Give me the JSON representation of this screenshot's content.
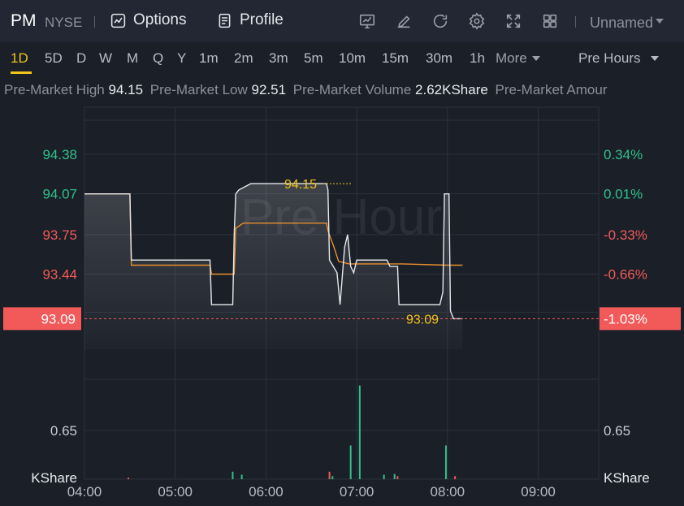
{
  "header": {
    "symbol": "PM",
    "exchange": "NYSE",
    "options_label": "Options",
    "profile_label": "Profile",
    "tools": [
      "chart-icon",
      "pencil-icon",
      "refresh-icon",
      "gear-icon",
      "fullscreen-icon",
      "grid-icon"
    ],
    "layout_name": "Unnamed"
  },
  "periods": {
    "items": [
      "1D",
      "5D",
      "D",
      "W",
      "M",
      "Q",
      "Y",
      "1m",
      "2m",
      "3m",
      "5m",
      "10m",
      "15m",
      "30m",
      "1h"
    ],
    "active": "1D",
    "more_label": "More",
    "session_label": "Pre Hours"
  },
  "stats": {
    "high_label": "Pre-Market High",
    "high_value": "94.15",
    "low_label": "Pre-Market Low",
    "low_value": "92.51",
    "volume_label": "Pre-Market Volume",
    "volume_value": "2.62KShare",
    "amount_label": "Pre-Market Amour"
  },
  "chart_data": {
    "type": "line",
    "watermark": "Pre Hour",
    "x_ticks": [
      "04:00",
      "05:00",
      "06:00",
      "07:00",
      "08:00",
      "09:00"
    ],
    "price_ticks": [
      94.38,
      94.07,
      93.75,
      93.44
    ],
    "price_tick_labels": [
      "94.38",
      "94.07",
      "93.75",
      "93.44"
    ],
    "pct_tick_labels": [
      "0.34%",
      "0.01%",
      "-0.33%",
      "-0.66%"
    ],
    "current_price": "93.09",
    "current_pct": "-1.03%",
    "high_marker": "94.15",
    "volume_tick": "0.65",
    "volume_unit": "KShare",
    "colors": {
      "up": "#2fc18a",
      "down": "#f25a5a",
      "price_line": "#e6e8ec",
      "avg_line": "#e8912c",
      "accent": "#f0c419",
      "current_badge": "#f25a5a"
    },
    "y_range": [
      92.85,
      94.75
    ],
    "price_series": [
      [
        "04:00",
        94.07
      ],
      [
        "04:30",
        94.07
      ],
      [
        "04:31",
        93.55
      ],
      [
        "05:00",
        93.55
      ],
      [
        "05:23",
        93.55
      ],
      [
        "05:24",
        93.2
      ],
      [
        "05:38",
        93.2
      ],
      [
        "05:39",
        93.75
      ],
      [
        "05:40",
        94.07
      ],
      [
        "05:42",
        94.1
      ],
      [
        "05:50",
        94.15
      ],
      [
        "06:00",
        94.15
      ],
      [
        "06:40",
        94.15
      ],
      [
        "06:41",
        94.1
      ],
      [
        "06:42",
        93.55
      ],
      [
        "06:47",
        93.45
      ],
      [
        "06:49",
        93.2
      ],
      [
        "06:52",
        93.65
      ],
      [
        "06:54",
        93.75
      ],
      [
        "06:56",
        93.5
      ],
      [
        "06:58",
        93.45
      ],
      [
        "07:00",
        93.55
      ],
      [
        "07:20",
        93.55
      ],
      [
        "07:22",
        93.5
      ],
      [
        "07:27",
        93.5
      ],
      [
        "07:28",
        93.2
      ],
      [
        "07:55",
        93.2
      ],
      [
        "07:57",
        93.3
      ],
      [
        "07:58",
        94.07
      ],
      [
        "08:01",
        94.07
      ],
      [
        "08:02",
        93.15
      ],
      [
        "08:04",
        93.09
      ],
      [
        "08:10",
        93.09
      ]
    ],
    "avg_series": [
      [
        "04:00",
        94.07
      ],
      [
        "04:30",
        94.07
      ],
      [
        "04:31",
        93.51
      ],
      [
        "05:00",
        93.51
      ],
      [
        "05:23",
        93.51
      ],
      [
        "05:24",
        93.44
      ],
      [
        "05:39",
        93.44
      ],
      [
        "05:40",
        93.8
      ],
      [
        "05:45",
        93.84
      ],
      [
        "06:00",
        93.84
      ],
      [
        "06:40",
        93.84
      ],
      [
        "06:41",
        93.78
      ],
      [
        "06:45",
        93.65
      ],
      [
        "06:48",
        93.54
      ],
      [
        "06:55",
        93.52
      ],
      [
        "07:00",
        93.52
      ],
      [
        "07:30",
        93.52
      ],
      [
        "08:00",
        93.51
      ],
      [
        "08:10",
        93.51
      ]
    ],
    "volume_bars": [
      {
        "t": "04:29",
        "v": 0.02,
        "dir": "down"
      },
      {
        "t": "05:38",
        "v": 0.1,
        "dir": "up"
      },
      {
        "t": "05:44",
        "v": 0.06,
        "dir": "up"
      },
      {
        "t": "06:42",
        "v": 0.1,
        "dir": "down"
      },
      {
        "t": "06:44",
        "v": 0.04,
        "dir": "up"
      },
      {
        "t": "06:56",
        "v": 0.45,
        "dir": "up"
      },
      {
        "t": "07:02",
        "v": 1.25,
        "dir": "up"
      },
      {
        "t": "07:18",
        "v": 0.06,
        "dir": "up"
      },
      {
        "t": "07:25",
        "v": 0.07,
        "dir": "up"
      },
      {
        "t": "07:27",
        "v": 0.04,
        "dir": "down"
      },
      {
        "t": "07:59",
        "v": 0.45,
        "dir": "up"
      },
      {
        "t": "08:05",
        "v": 0.04,
        "dir": "down"
      }
    ],
    "volume_range": [
      0,
      1.3
    ]
  }
}
